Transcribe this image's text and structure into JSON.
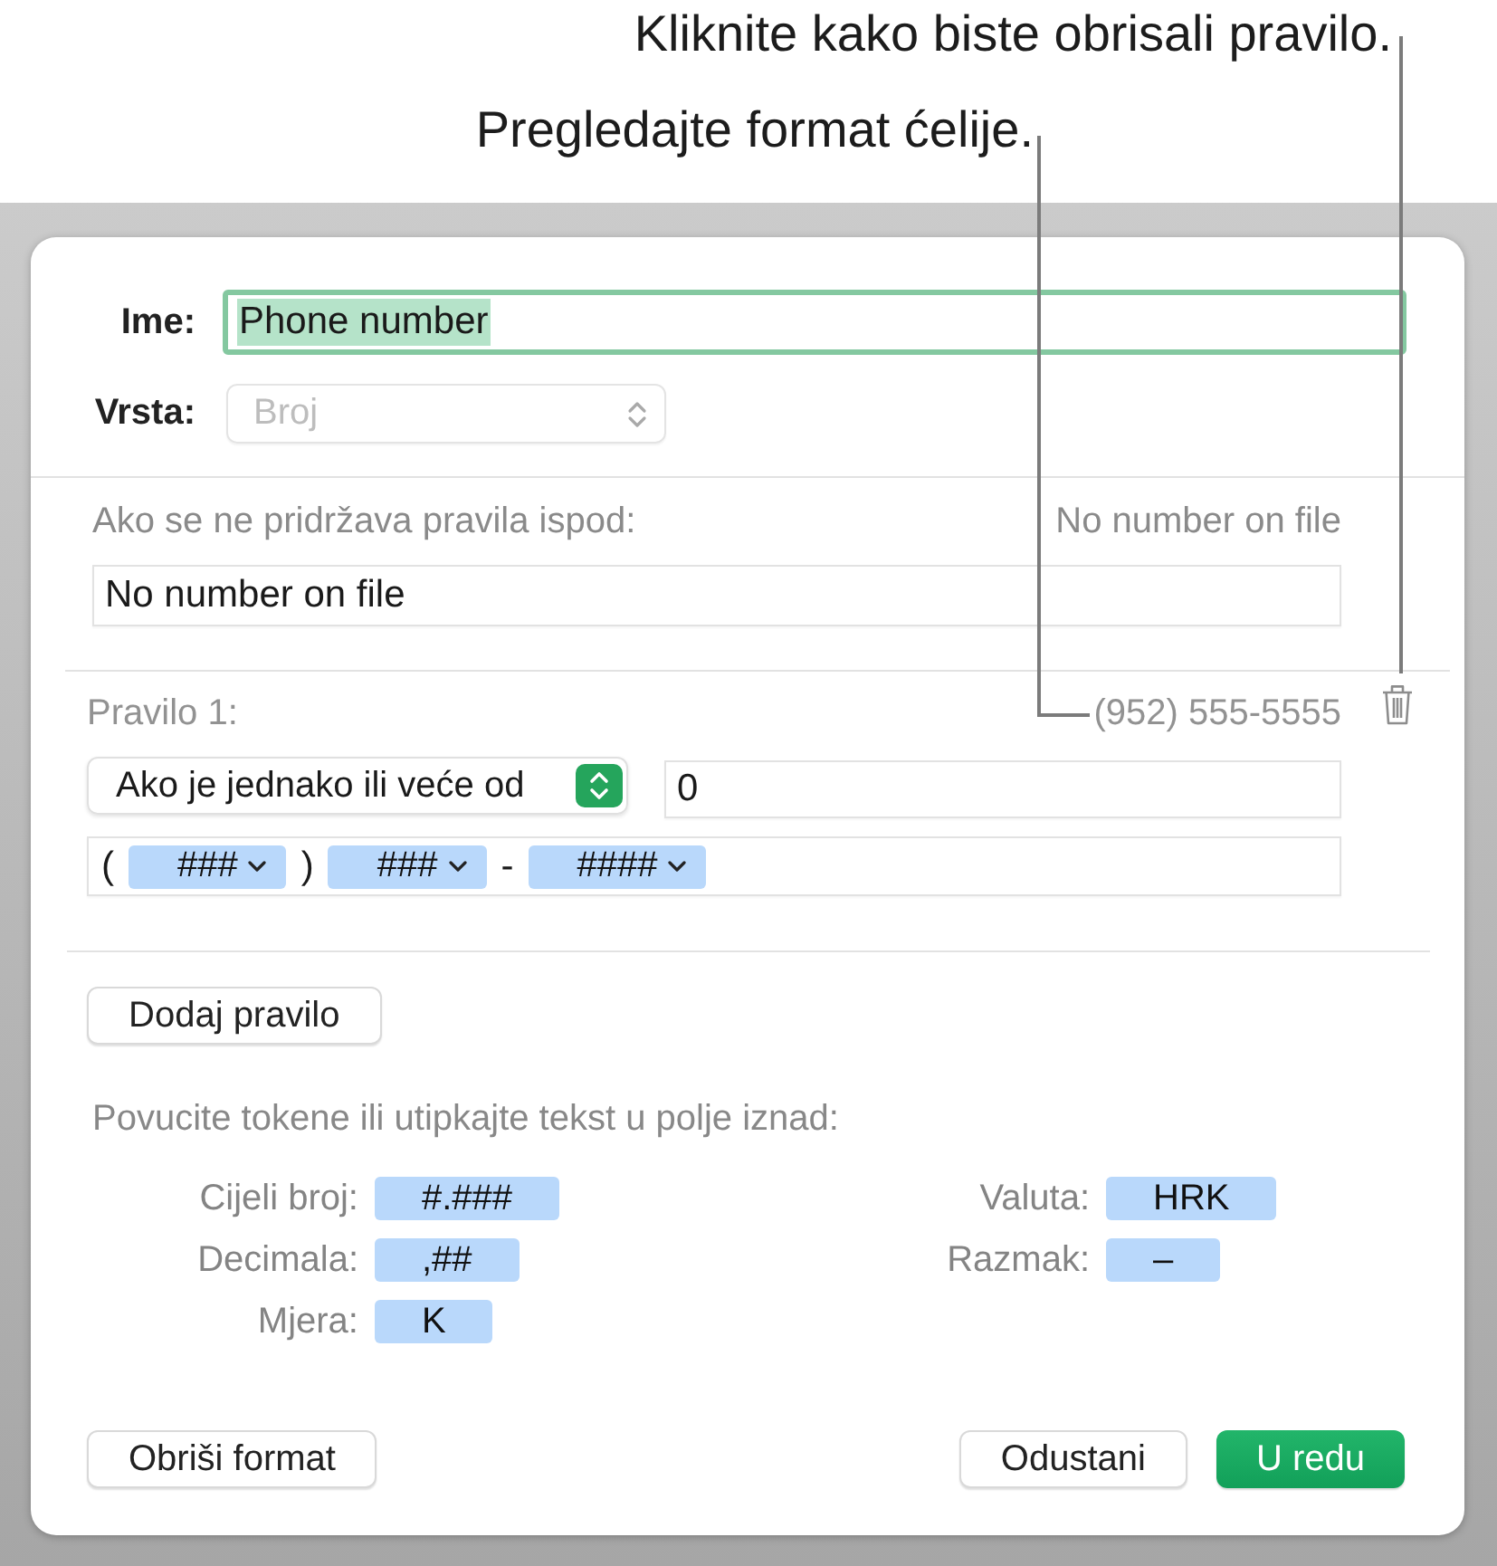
{
  "callouts": [
    {
      "text": "Kliknite kako biste obrisali pravilo."
    },
    {
      "text": "Pregledajte format ćelije."
    }
  ],
  "dialog": {
    "name_field": {
      "label": "Ime:",
      "value": "Phone number",
      "focused": true,
      "text_selected": true
    },
    "type_popup": {
      "label": "Vrsta:",
      "value": "Broj",
      "disabled": true
    },
    "fallback": {
      "label": "Ako se ne pridržava pravila ispod:",
      "preview": "No number on file",
      "value": "No number on file"
    },
    "rules": [
      {
        "title": "Pravilo 1:",
        "preview": "(952) 555-5555",
        "condition": "Ako je jednako ili veće od",
        "threshold": "0",
        "format": [
          {
            "kind": "text",
            "text": "("
          },
          {
            "kind": "token",
            "text": "###"
          },
          {
            "kind": "text",
            "text": ")"
          },
          {
            "kind": "token",
            "text": "###"
          },
          {
            "kind": "text",
            "text": "-"
          },
          {
            "kind": "token",
            "text": "####"
          }
        ]
      }
    ],
    "add_rule_button": "Dodaj pravilo",
    "tokens_hint": "Povucite tokene ili utipkajte tekst u polje iznad:",
    "token_columns": [
      [
        {
          "label": "Cijeli broj:",
          "token": "#.###"
        },
        {
          "label": "Decimala:",
          "token": ",##"
        },
        {
          "label": "Mjera:",
          "token": "K"
        }
      ],
      [
        {
          "label": "Valuta:",
          "token": "HRK"
        },
        {
          "label": "Razmak:",
          "token": "–"
        }
      ]
    ],
    "buttons": [
      {
        "label": "Obriši format",
        "kind": "default"
      },
      {
        "label": "Odustani",
        "kind": "default"
      },
      {
        "label": "U redu",
        "kind": "primary"
      }
    ]
  }
}
